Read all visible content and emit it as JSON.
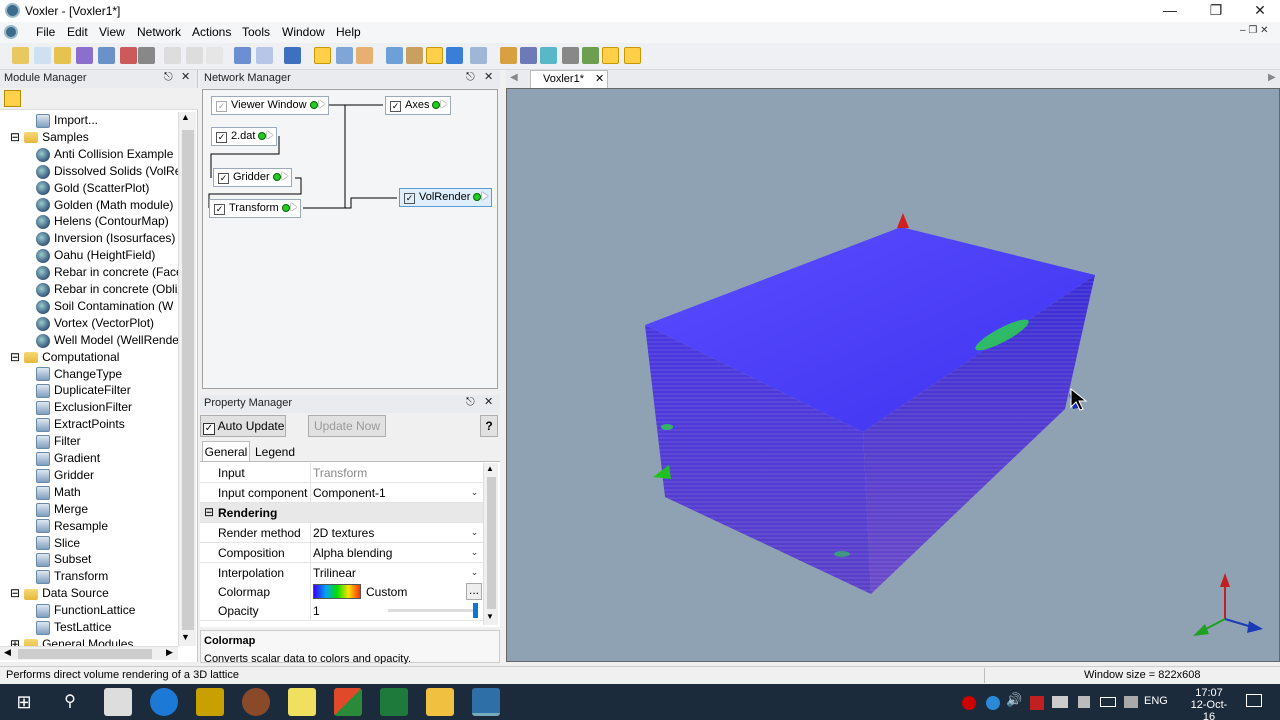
{
  "window": {
    "title": "Voxler - [Voxler1*]"
  },
  "menu": [
    "File",
    "Edit",
    "View",
    "Network",
    "Actions",
    "Tools",
    "Window",
    "Help"
  ],
  "module_manager": {
    "title": "Module Manager",
    "tree": [
      {
        "label": "Import...",
        "level": 1,
        "icon": "import-icon"
      },
      {
        "label": "Samples",
        "level": 0,
        "icon": "folder-icon",
        "expanded": true
      },
      {
        "label": "Anti Collision Example",
        "level": 1,
        "icon": "globe-icon"
      },
      {
        "label": "Dissolved Solids (VolRe",
        "level": 1,
        "icon": "globe-icon"
      },
      {
        "label": "Gold (ScatterPlot)",
        "level": 1,
        "icon": "globe-icon"
      },
      {
        "label": "Golden (Math module)",
        "level": 1,
        "icon": "globe-icon"
      },
      {
        "label": "Helens (ContourMap)",
        "level": 1,
        "icon": "globe-icon"
      },
      {
        "label": "Inversion (Isosurfaces)",
        "level": 1,
        "icon": "globe-icon"
      },
      {
        "label": "Oahu (HeightField)",
        "level": 1,
        "icon": "globe-icon"
      },
      {
        "label": "Rebar in concrete (Face",
        "level": 1,
        "icon": "globe-icon"
      },
      {
        "label": "Rebar in concrete (Obli",
        "level": 1,
        "icon": "globe-icon"
      },
      {
        "label": "Soil Contamination (W",
        "level": 1,
        "icon": "globe-icon"
      },
      {
        "label": "Vortex (VectorPlot)",
        "level": 1,
        "icon": "globe-icon"
      },
      {
        "label": "Well Model (WellRende",
        "level": 1,
        "icon": "globe-icon"
      },
      {
        "label": "Computational",
        "level": 0,
        "icon": "folder-icon",
        "expanded": true
      },
      {
        "label": "ChangeType",
        "level": 1,
        "icon": "module-icon"
      },
      {
        "label": "DuplicateFilter",
        "level": 1,
        "icon": "module-icon"
      },
      {
        "label": "ExclusionFilter",
        "level": 1,
        "icon": "module-icon"
      },
      {
        "label": "ExtractPoints",
        "level": 1,
        "icon": "module-icon"
      },
      {
        "label": "Filter",
        "level": 1,
        "icon": "module-icon"
      },
      {
        "label": "Gradient",
        "level": 1,
        "icon": "module-icon"
      },
      {
        "label": "Gridder",
        "level": 1,
        "icon": "module-icon"
      },
      {
        "label": "Math",
        "level": 1,
        "icon": "module-icon"
      },
      {
        "label": "Merge",
        "level": 1,
        "icon": "module-icon"
      },
      {
        "label": "Resample",
        "level": 1,
        "icon": "module-icon"
      },
      {
        "label": "Slice",
        "level": 1,
        "icon": "module-icon"
      },
      {
        "label": "Subset",
        "level": 1,
        "icon": "module-icon"
      },
      {
        "label": "Transform",
        "level": 1,
        "icon": "module-icon"
      },
      {
        "label": "Data Source",
        "level": 0,
        "icon": "folder-icon",
        "expanded": true
      },
      {
        "label": "FunctionLattice",
        "level": 1,
        "icon": "module-icon"
      },
      {
        "label": "TestLattice",
        "level": 1,
        "icon": "module-icon"
      },
      {
        "label": "General Modules",
        "level": 0,
        "icon": "folder-icon"
      }
    ]
  },
  "network_manager": {
    "title": "Network Manager",
    "modules": [
      "Viewer Window",
      "2.dat",
      "Gridder",
      "Transform",
      "Axes",
      "VolRender"
    ]
  },
  "property_manager": {
    "title": "Property Manager",
    "auto_update": "Auto Update",
    "update_now": "Update Now",
    "help": "?",
    "tabs": [
      "General",
      "Legend"
    ],
    "rows": {
      "input": {
        "k": "Input",
        "v": "Transform"
      },
      "input_component": {
        "k": "Input component",
        "v": "Component-1"
      },
      "rendering": "Rendering",
      "render_method": {
        "k": "Render method",
        "v": "2D textures"
      },
      "composition": {
        "k": "Composition",
        "v": "Alpha blending"
      },
      "interpolation": {
        "k": "Interpolation",
        "v": "Trilinear"
      },
      "colormap": {
        "k": "Colormap",
        "v": "Custom",
        "more": "..."
      },
      "opacity": {
        "k": "Opacity",
        "v": "1",
        "level": 1.0
      }
    },
    "desc_title": "Colormap",
    "desc_text": "Converts scalar data to colors and opacity."
  },
  "viewer": {
    "tab": "Voxler1*"
  },
  "status": {
    "left": "Performs direct volume rendering of a 3D lattice",
    "right": "Window size = 822x608"
  },
  "taskbar": {
    "lang": "ENG",
    "time": "17:07",
    "date": "12-Oct-16"
  },
  "colors": {
    "accent": "#3a67d8",
    "volume_top": "#4a40ff",
    "volume_side": "#3b2ed8"
  }
}
